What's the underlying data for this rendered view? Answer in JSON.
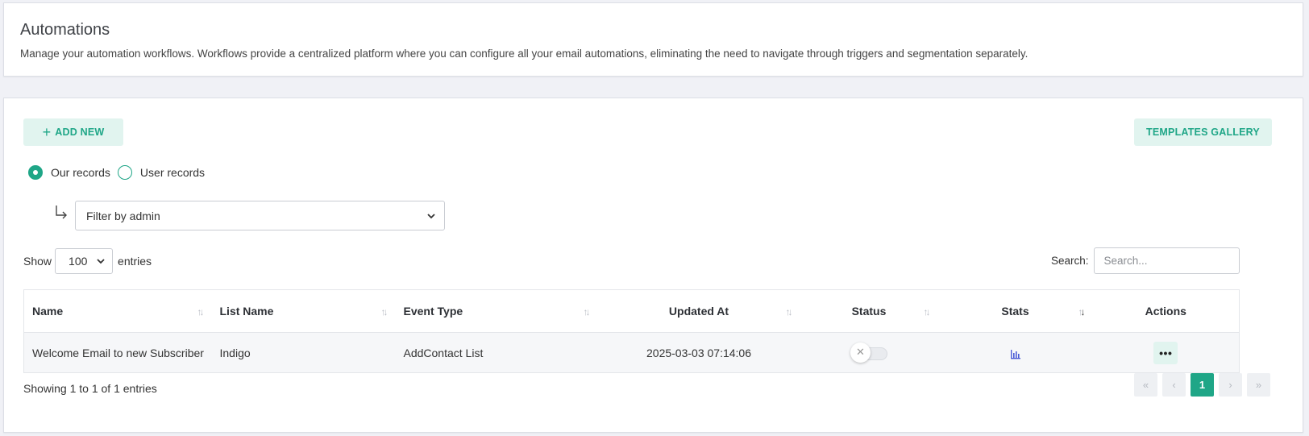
{
  "header": {
    "title": "Automations",
    "description": "Manage your automation workflows. Workflows provide a centralized platform where you can configure all your email automations, eliminating the need to navigate through triggers and segmentation separately."
  },
  "toolbar": {
    "add_new_label": "ADD NEW",
    "templates_gallery_label": "TEMPLATES GALLERY"
  },
  "records": {
    "our_records_label": "Our records",
    "user_records_label": "User records",
    "selected": "Our records"
  },
  "filter": {
    "selected_label": "Filter by admin"
  },
  "length": {
    "show_label": "Show",
    "entries_value": "100",
    "entries_label": "entries"
  },
  "search": {
    "label": "Search:",
    "placeholder": "Search..."
  },
  "table": {
    "columns": [
      "Name",
      "List Name",
      "Event Type",
      "Updated At",
      "Status",
      "Stats",
      "Actions"
    ],
    "rows": [
      {
        "name": "Welcome Email to new Subscriber",
        "list_name": "Indigo",
        "event_type": "AddContact List",
        "updated_at": "2025-03-03 07:14:06",
        "status": "off",
        "actions_label": "•••"
      }
    ]
  },
  "footer": {
    "info": "Showing 1 to 1 of 1 entries",
    "current_page": "1",
    "first_glyph": "«",
    "prev_glyph": "‹",
    "next_glyph": "›",
    "last_glyph": "»"
  },
  "colors": {
    "accent": "#1fa687",
    "accent_soft": "#e1f4ef",
    "page_bg": "#f0f1f6"
  },
  "icons": [
    "plus-icon",
    "return-arrow-icon",
    "chevron-down-icon",
    "sort-icon",
    "close-icon",
    "bar-chart-icon",
    "more-icon"
  ]
}
